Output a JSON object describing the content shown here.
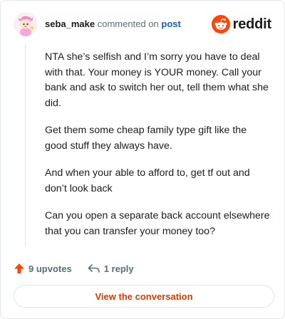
{
  "header": {
    "username": "seba_make",
    "action_text": "commented on",
    "post_link": "post",
    "brand": "reddit",
    "brand_color": "#ff4500"
  },
  "comment": {
    "paragraphs": [
      "NTA she’s selfish and I’m sorry you have to deal with that. Your money is YOUR money. Call your bank and ask to switch her out, tell them what she did.",
      "Get them some cheap family type gift like the good stuff they always have.",
      "And when your able to afford to, get tf out and don’t look back",
      "Can you open a separate back account elsewhere that you can transfer your money too?"
    ]
  },
  "footer": {
    "upvotes": "9 upvotes",
    "replies": "1 reply",
    "upvote_icon": "upvote-arrow-icon",
    "reply_icon": "reply-arrow-icon",
    "upvote_color": "#ff4500"
  },
  "cta": {
    "label": "View the conversation",
    "color": "#d93a00"
  }
}
